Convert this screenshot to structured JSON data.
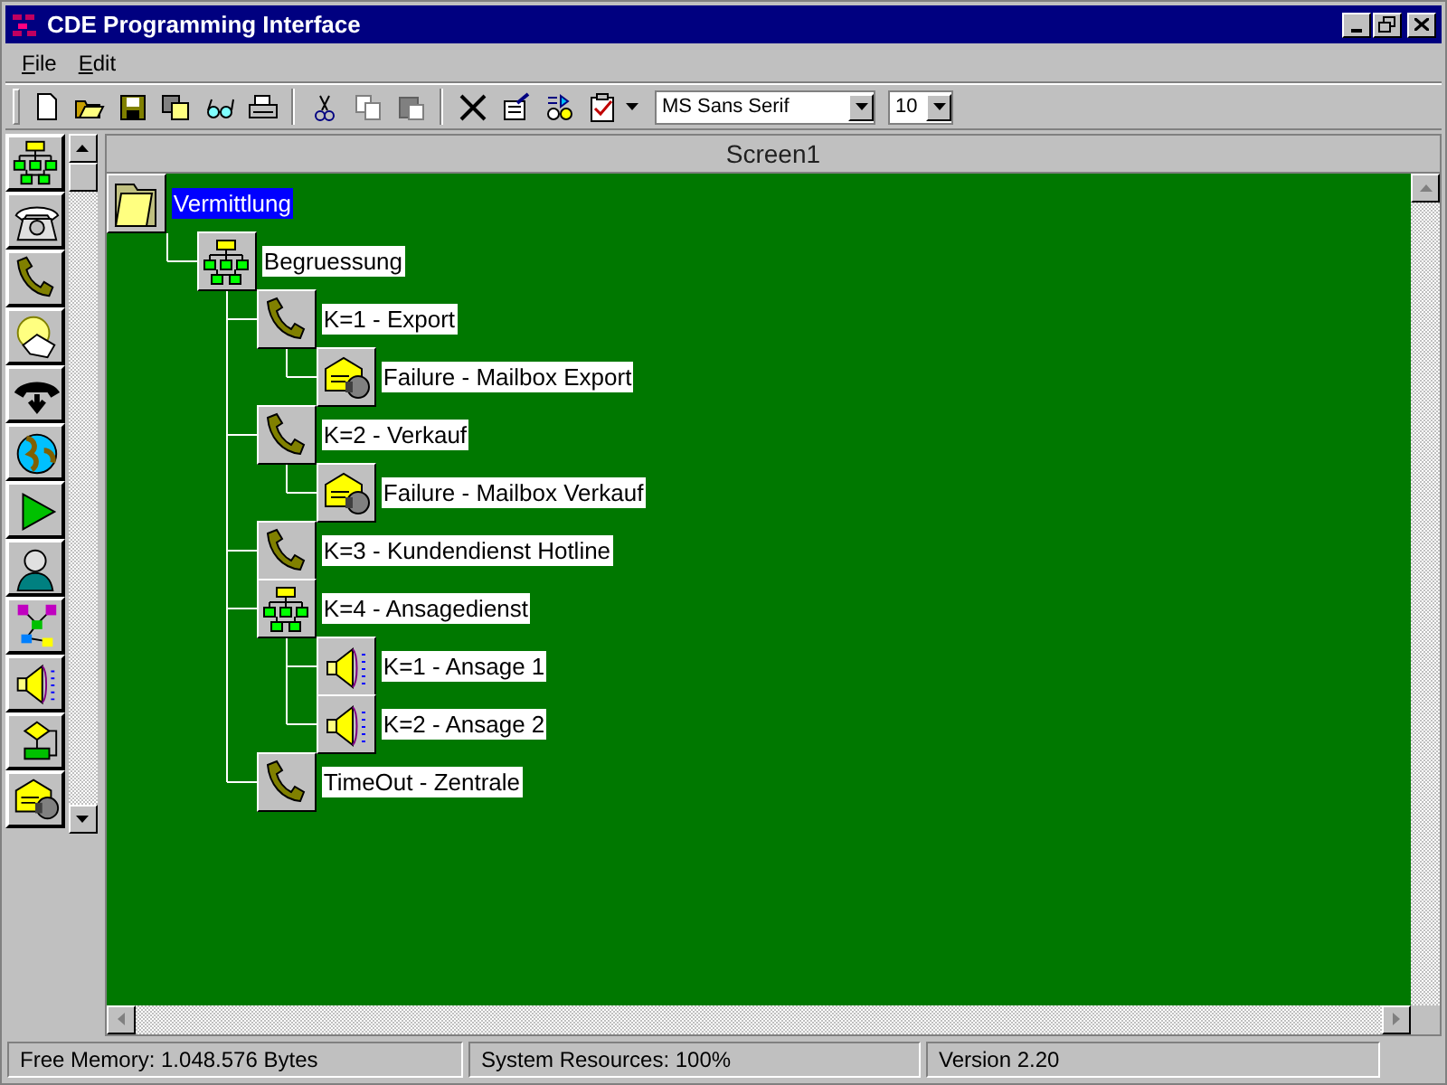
{
  "window": {
    "title": "CDE Programming Interface"
  },
  "menu": [
    "File",
    "Edit"
  ],
  "toolbar": {
    "font": "MS Sans Serif",
    "size": "10"
  },
  "document": {
    "title": "Screen1",
    "tree": {
      "label": "Vermittlung",
      "kind": "folder",
      "selected": true,
      "children": [
        {
          "label": "Begruessung",
          "kind": "hierarchy",
          "selected": false,
          "children": [
            {
              "label": "K=1 - Export",
              "kind": "phone",
              "selected": false,
              "children": [
                {
                  "label": "Failure - Mailbox Export",
                  "kind": "mailbox",
                  "selected": false
                }
              ]
            },
            {
              "label": "K=2 - Verkauf",
              "kind": "phone",
              "selected": false,
              "children": [
                {
                  "label": "Failure - Mailbox Verkauf",
                  "kind": "mailbox",
                  "selected": false
                }
              ]
            },
            {
              "label": "K=3 - Kundendienst Hotline",
              "kind": "phone",
              "selected": false
            },
            {
              "label": "K=4 - Ansagedienst",
              "kind": "hierarchy",
              "selected": false,
              "children": [
                {
                  "label": "K=1 - Ansage 1",
                  "kind": "speaker",
                  "selected": false
                },
                {
                  "label": "K=2 - Ansage 2",
                  "kind": "speaker",
                  "selected": false
                }
              ]
            },
            {
              "label": "TimeOut - Zentrale",
              "kind": "phone",
              "selected": false
            }
          ]
        }
      ]
    }
  },
  "status_bar": [
    "Free Memory: 1.048.576 Bytes",
    "System Resources: 100%",
    "Version 2.20"
  ]
}
